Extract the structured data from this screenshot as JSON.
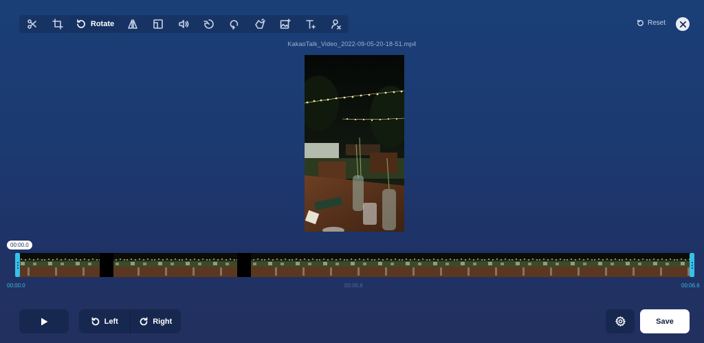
{
  "toolbar": {
    "tools": [
      {
        "icon": "scissors-icon",
        "label": ""
      },
      {
        "icon": "crop-icon",
        "label": ""
      },
      {
        "icon": "rotate-icon",
        "label": "Rotate"
      },
      {
        "icon": "flip-icon",
        "label": ""
      },
      {
        "icon": "resize-icon",
        "label": ""
      },
      {
        "icon": "volume-icon",
        "label": ""
      },
      {
        "icon": "speed-icon",
        "label": ""
      },
      {
        "icon": "loop-icon",
        "label": ""
      },
      {
        "icon": "stabilize-icon",
        "label": ""
      },
      {
        "icon": "add-image-icon",
        "label": ""
      },
      {
        "icon": "add-text-icon",
        "label": ""
      },
      {
        "icon": "remove-logo-icon",
        "label": ""
      }
    ],
    "active_tool": "rotate-icon",
    "reset_label": "Reset"
  },
  "video": {
    "filename": "KakaoTalk_Video_2022-09-05-20-18-51.mp4"
  },
  "timeline": {
    "current_time": "00:00.0",
    "start_label": "00:00.0",
    "mid_label": "00:06.6",
    "end_label": "00:06.6"
  },
  "controls": {
    "rotate_left_label": "Left",
    "rotate_right_label": "Right",
    "save_label": "Save"
  },
  "colors": {
    "accent": "#35c1ea",
    "panel": "#16284f",
    "background_top": "#1a3e76"
  }
}
